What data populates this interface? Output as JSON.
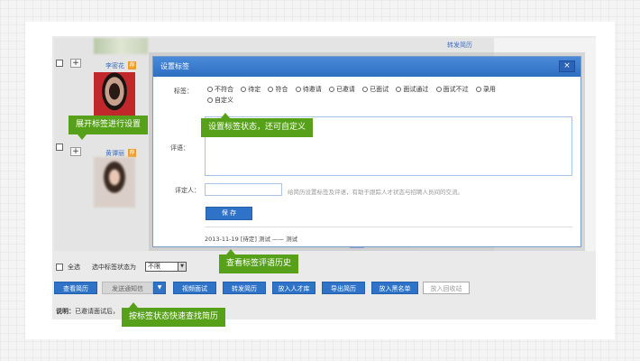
{
  "list": {
    "forward_link": "转发简历",
    "candidates": [
      {
        "name": "李密花",
        "badge": "荐"
      },
      {
        "name": "黄谭丽",
        "badge": "荐"
      }
    ],
    "plus_label": "+"
  },
  "toolbar": {
    "select_all": "全选",
    "filter_label": "选中标签状态为",
    "filter_value": "不限",
    "buttons": [
      "查看简历",
      "发送通知信",
      "视频面试",
      "转发简历",
      "放入人才库",
      "导出简历",
      "放入黑名单",
      "放入回收站"
    ],
    "note_prefix": "说明：",
    "note_text": "已邀请面试后，"
  },
  "dialog": {
    "title": "设置标签",
    "close": "×",
    "tag_label": "标签：",
    "tags": [
      "不符合",
      "待定",
      "符合",
      "待邀请",
      "已邀请",
      "已面试",
      "面试通过",
      "面试不过",
      "录用"
    ],
    "custom_tag": "自定义",
    "comment_label": "评语：",
    "rater_label": "评定人：",
    "hint": "给简历设置标签及评语，有助于跟踪人才状态与招聘人员间的交流。",
    "save": "保 存",
    "history": "2013-11-19  [待定]  测试 —— 测试"
  },
  "callouts": {
    "expand": "展开标签进行设置",
    "set_status": "设置标签状态，还可自定义",
    "history": "查看标签评语历史",
    "search": "按标签状态快速查找简历"
  },
  "colors": {
    "accent": "#2e73c7",
    "callout": "#57a11a",
    "badge": "#f39a2c"
  }
}
